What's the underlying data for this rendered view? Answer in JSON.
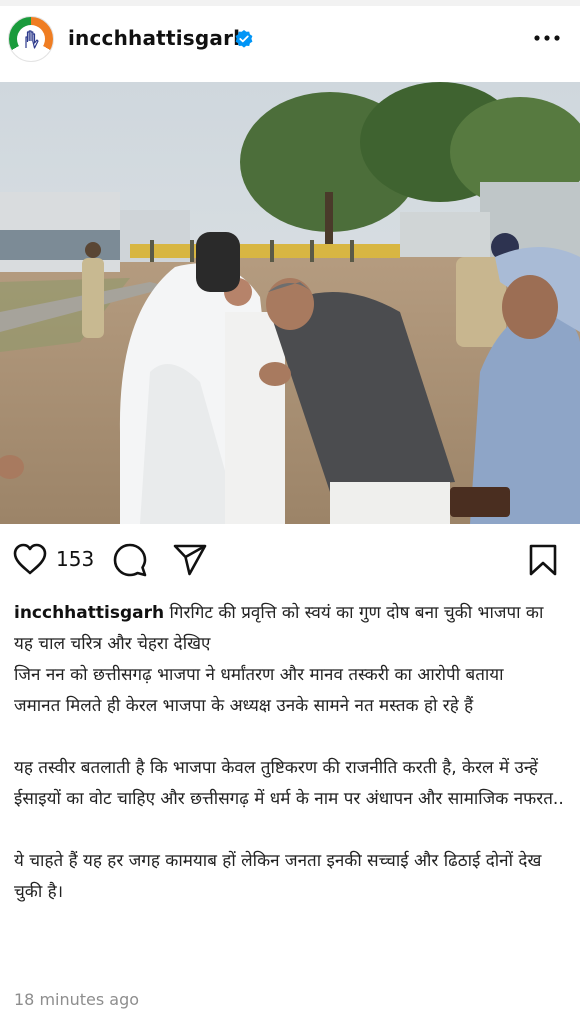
{
  "post": {
    "username": "incchhattisgarh",
    "verified": true,
    "more_icon": "more-horizontal-icon",
    "likes": "153",
    "caption_lines": [
      "गिरगिट की प्रवृत्ति को स्वयं का गुण दोष बना चुकी भाजपा का यह चाल चरित्र और चेहरा देखिए",
      "जिन नन को छत्तीसगढ़ भाजपा ने धर्मांतरण और मानव तस्करी का आरोपी बताया",
      "जमानत मिलते ही केरल भाजपा के अध्यक्ष उनके सामने नत मस्तक हो रहे हैं",
      "",
      "यह तस्वीर बतलाती है कि भाजपा केवल तुष्टिकरण की राजनीति करती है, केरल में उन्हें ईसाइयों का वोट चाहिए और छत्तीसगढ़ में धर्म के नाम पर अंधापन और सामाजिक नफरत..",
      "",
      "ये चाहते हैं यह हर जगह कामयाब हों लेकिन जनता इनकी सच्चाई और ढिठाई दोनों देख चुकी है।"
    ],
    "timestamp": "18 minutes ago"
  },
  "icons": {
    "like": "heart-icon",
    "comment": "comment-icon",
    "share": "paper-plane-icon",
    "save": "bookmark-icon",
    "verified": "verified-badge-icon"
  },
  "colors": {
    "verified_blue": "#0095f6",
    "saffron": "#ef7d22",
    "green": "#1a9b3c"
  }
}
